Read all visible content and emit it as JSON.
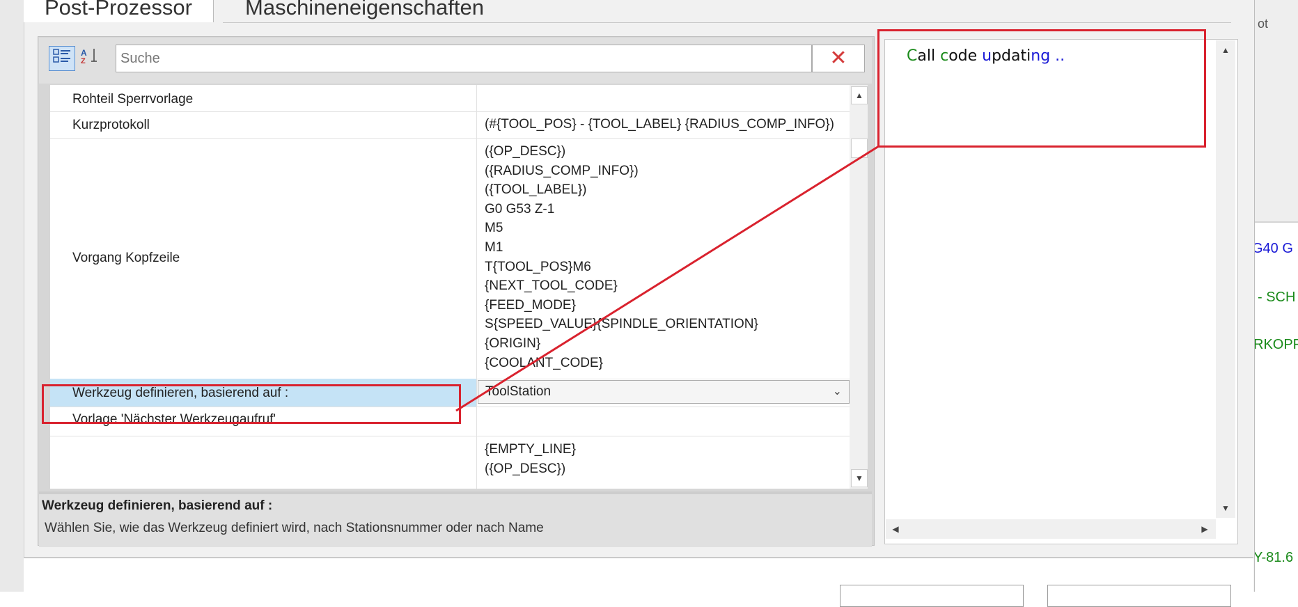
{
  "tabs": [
    {
      "label": "Post-Prozessor",
      "active": true
    },
    {
      "label": "Maschineneigenschaften",
      "active": false
    }
  ],
  "background_right": {
    "top_text": "ot",
    "snippets": [
      "G40 G",
      "- SCH",
      "RKOPF",
      "Y-81.6"
    ]
  },
  "toolbar": {
    "categorized_icon": "categorized-view-icon",
    "alpha_icon": "alphabetical-sort-icon",
    "search_placeholder": "Suche",
    "clear_icon": "clear-search-icon"
  },
  "properties": [
    {
      "name": "Rohteil Sperrvorlage",
      "value": []
    },
    {
      "name": "Kurzprotokoll",
      "value": [
        "(#{TOOL_POS} - {TOOL_LABEL} {RADIUS_COMP_INFO})"
      ]
    },
    {
      "name": "Vorgang Kopfzeile",
      "value": [
        "({OP_DESC})",
        "({RADIUS_COMP_INFO})",
        "({TOOL_LABEL})",
        "G0 G53 Z-1",
        "M5",
        "M1",
        "T{TOOL_POS}M6",
        "{NEXT_TOOL_CODE}",
        "{FEED_MODE}",
        "S{SPEED_VALUE}{SPINDLE_ORIENTATION}",
        "{ORIGIN}",
        "{COOLANT_CODE}"
      ]
    },
    {
      "name": "Werkzeug definieren, basierend auf :",
      "value": [
        "ToolStation"
      ],
      "selected": true
    },
    {
      "name": "Vorlage 'Nächster Werkzeugaufruf'",
      "value": []
    },
    {
      "name": "",
      "value": [
        "{EMPTY_LINE}",
        "({OP_DESC})"
      ]
    }
  ],
  "help": {
    "title": "Werkzeug definieren, basierend auf :",
    "description": "Wählen Sie, wie das Werkzeug definiert wird, nach Stationsnummer oder nach Name"
  },
  "preview": {
    "segments": [
      {
        "text": "C",
        "color": "#1a8a1a"
      },
      {
        "text": "all ",
        "color": "#111111"
      },
      {
        "text": "c",
        "color": "#1a8a1a"
      },
      {
        "text": "ode ",
        "color": "#111111"
      },
      {
        "text": "u",
        "color": "#1a1ad6"
      },
      {
        "text": "pdati",
        "color": "#111111"
      },
      {
        "text": "ng ..",
        "color": "#1a1ad6"
      }
    ]
  },
  "colors": {
    "highlight": "#d9222e",
    "selection": "#c5e3f6"
  }
}
